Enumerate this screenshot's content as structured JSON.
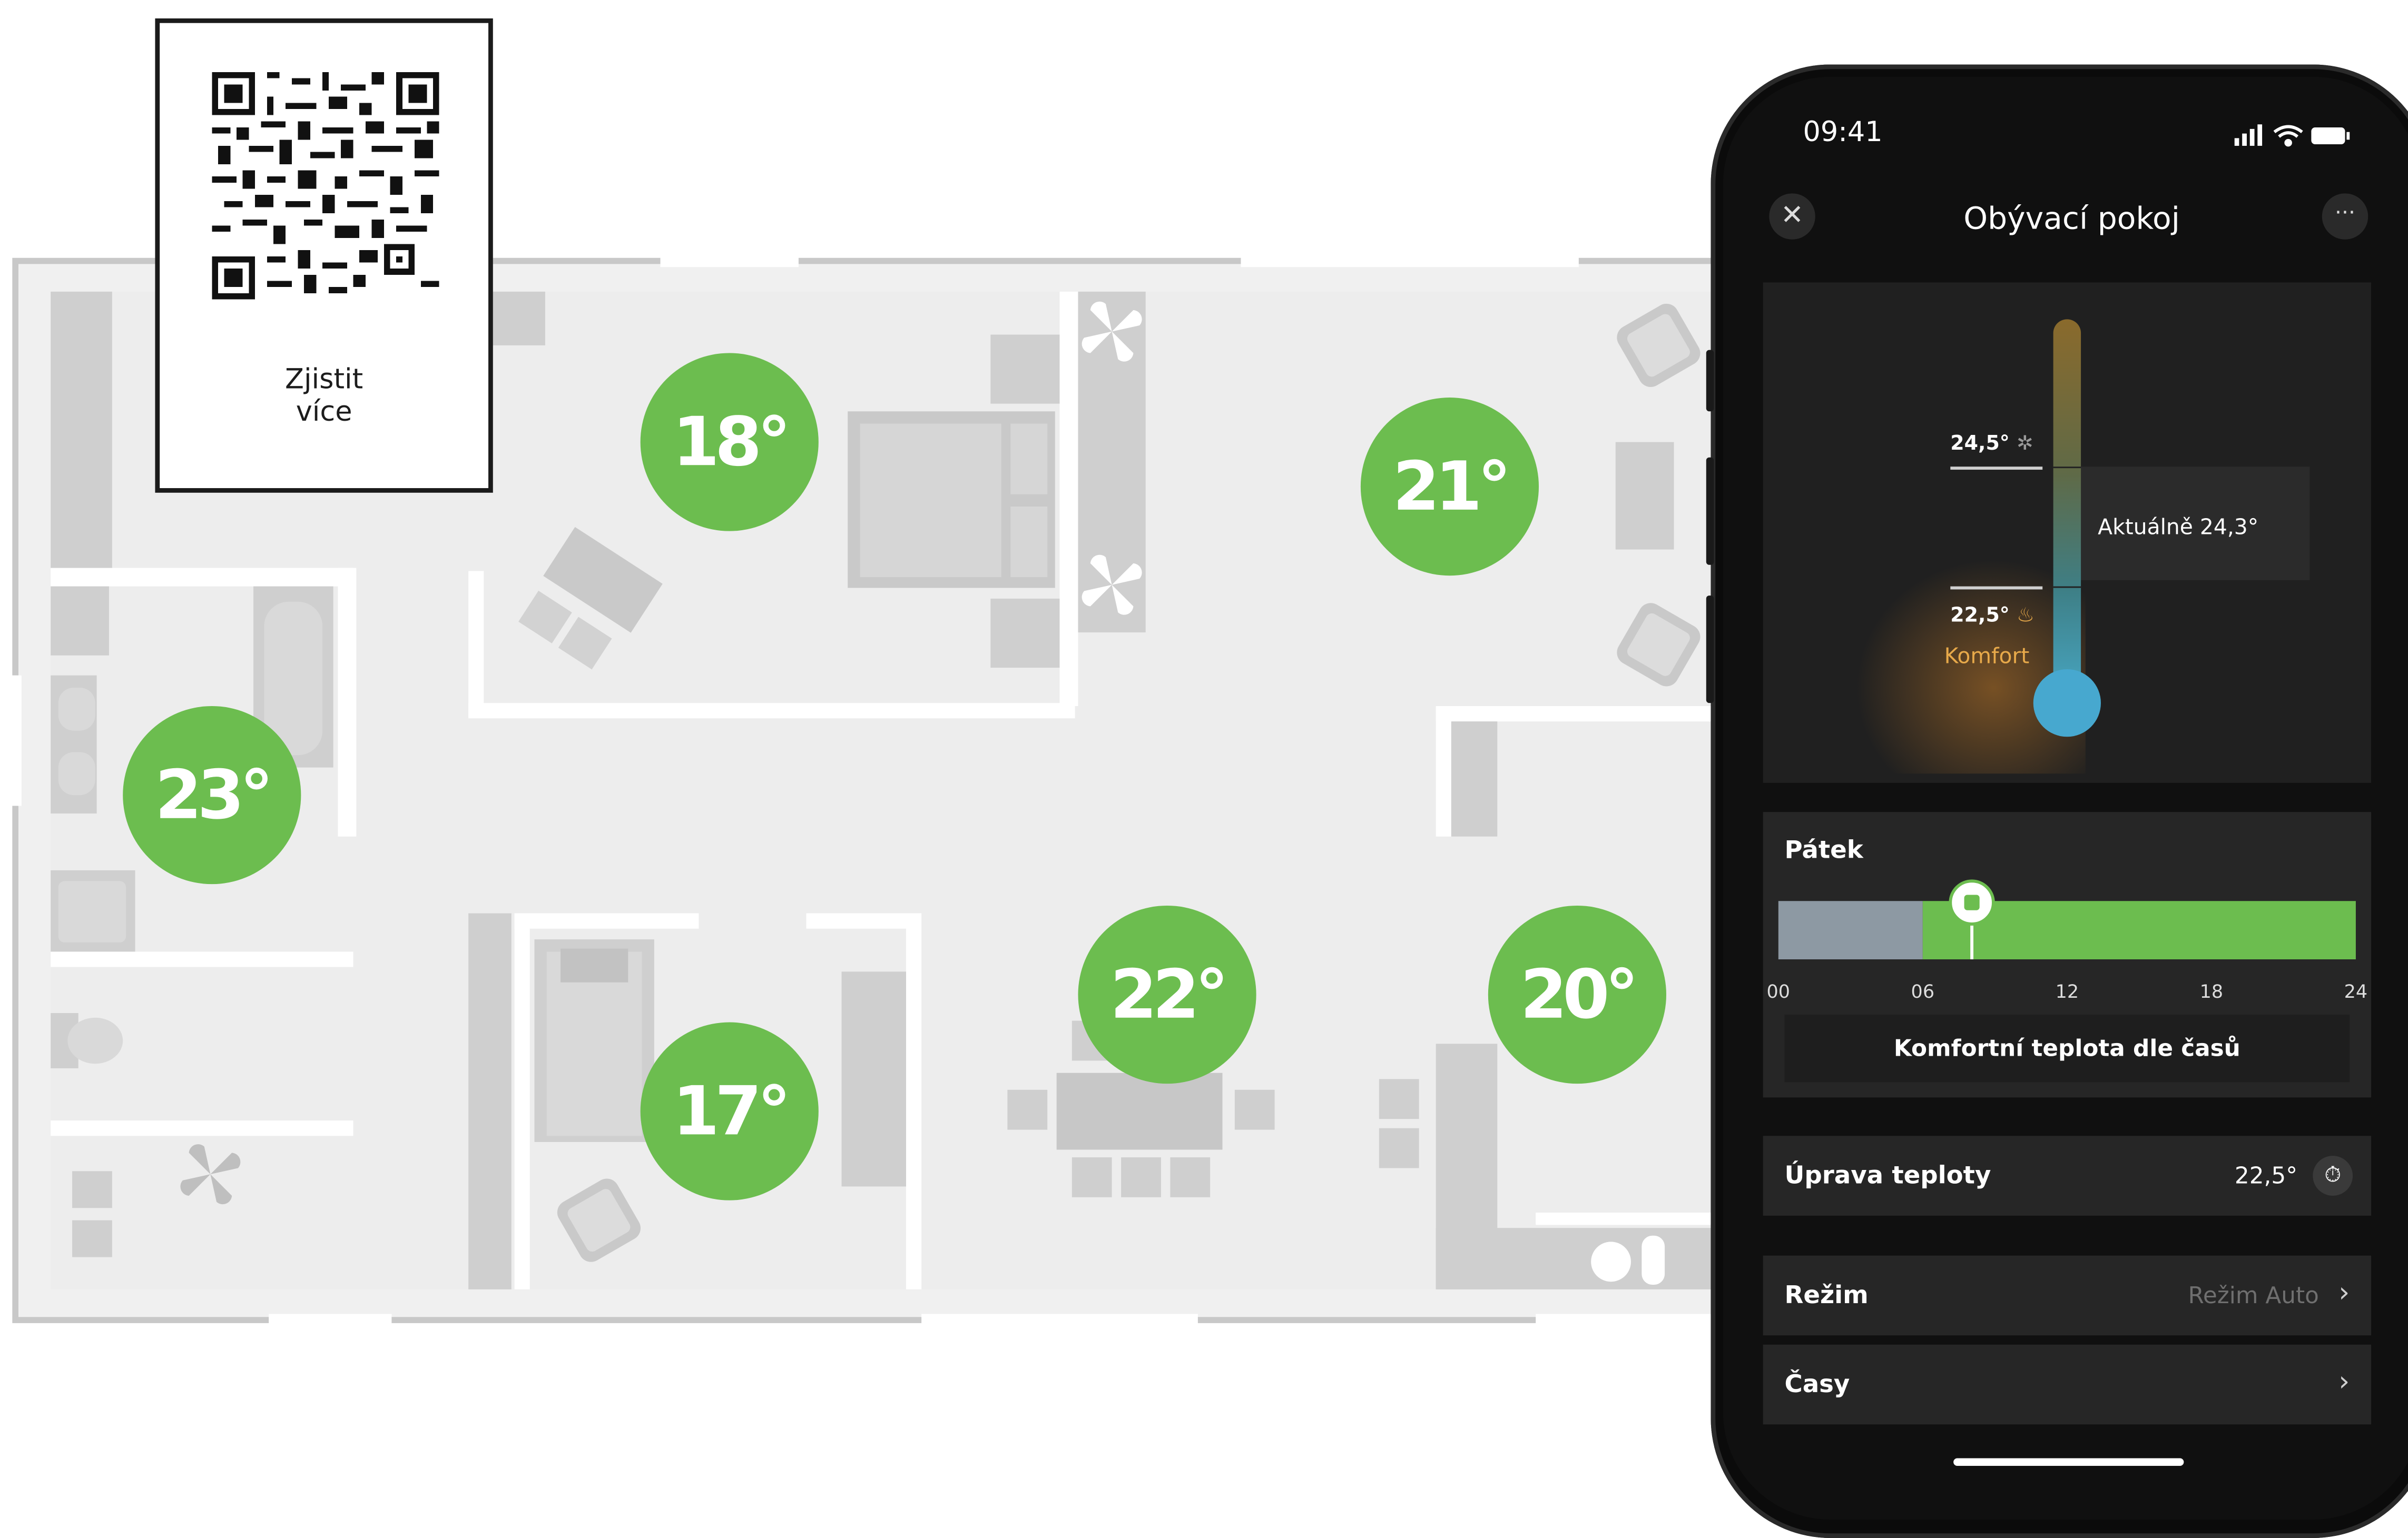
{
  "qr_card": {
    "caption_line1": "Zjistit",
    "caption_line2": "více"
  },
  "floorplan": {
    "room_temps": [
      {
        "room": "bedroom",
        "label": "18°"
      },
      {
        "room": "hall",
        "label": "21°"
      },
      {
        "room": "bathroom",
        "label": "23°"
      },
      {
        "room": "kids-room",
        "label": "17°"
      },
      {
        "room": "dining",
        "label": "22°"
      },
      {
        "room": "kitchen",
        "label": "20°"
      }
    ],
    "accent_color": "#6cbd4f"
  },
  "phone": {
    "status_time": "09:41",
    "icons": [
      "close-icon",
      "more-icon",
      "signal-icon",
      "wifi-icon",
      "battery-icon"
    ],
    "title": "Obývací pokoj",
    "thermometer": {
      "upper_label": "24,5°",
      "lower_label": "22,5°",
      "mode_label": "Komfort",
      "current_label": "Aktuálně 24,3°",
      "upper_icon": "snowflake-icon",
      "lower_icon": "flame-icon"
    },
    "schedule": {
      "day": "Pátek",
      "hours": [
        "00",
        "06",
        "12",
        "18",
        "24"
      ],
      "button_label": "Komfortní teplota dle časů"
    },
    "rows": {
      "adjust": {
        "label": "Úprava teploty",
        "value": "22,5°",
        "icon": "timer-icon"
      },
      "mode": {
        "label": "Režim",
        "value": "Režim Auto"
      },
      "times": {
        "label": "Časy"
      }
    }
  }
}
